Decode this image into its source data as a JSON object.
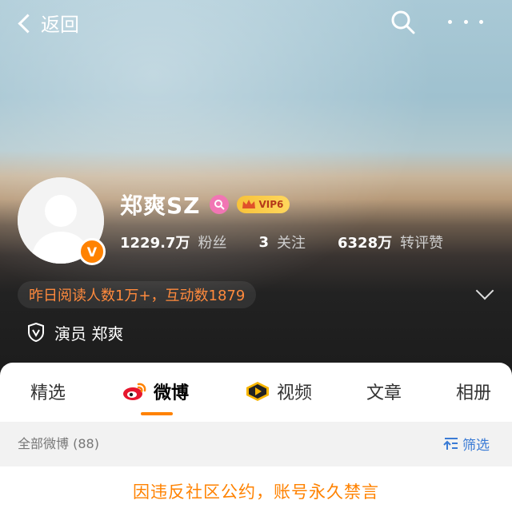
{
  "header": {
    "back_label": "返回"
  },
  "profile": {
    "username": "郑爽SZ",
    "vip_label": "VIP6",
    "verified_symbol": "V",
    "stats": {
      "fans_count": "1229.7万",
      "fans_label": "粉丝",
      "following_count": "3",
      "following_label": "关注",
      "engagement_count": "6328万",
      "engagement_label": "转评赞"
    },
    "reading_summary": "昨日阅读人数1万+，互动数1879",
    "verification_text": "演员 郑爽"
  },
  "tabs": [
    {
      "label": "精选",
      "icon": null
    },
    {
      "label": "微博",
      "icon": "weibo-logo-icon"
    },
    {
      "label": "视频",
      "icon": "video-play-icon"
    },
    {
      "label": "文章",
      "icon": null
    },
    {
      "label": "相册",
      "icon": null
    }
  ],
  "active_tab": "微博",
  "filter": {
    "count_label": "全部微博 (88)",
    "filter_label": "筛选"
  },
  "notice": {
    "banned_text": "因违反社区公约，账号永久禁言"
  },
  "colors": {
    "accent": "#ff8200",
    "link": "#3a7bd5",
    "reading_text": "#ff8a3d",
    "vip_gold": "#f7c23a",
    "pink_badge": "#f176b4"
  }
}
